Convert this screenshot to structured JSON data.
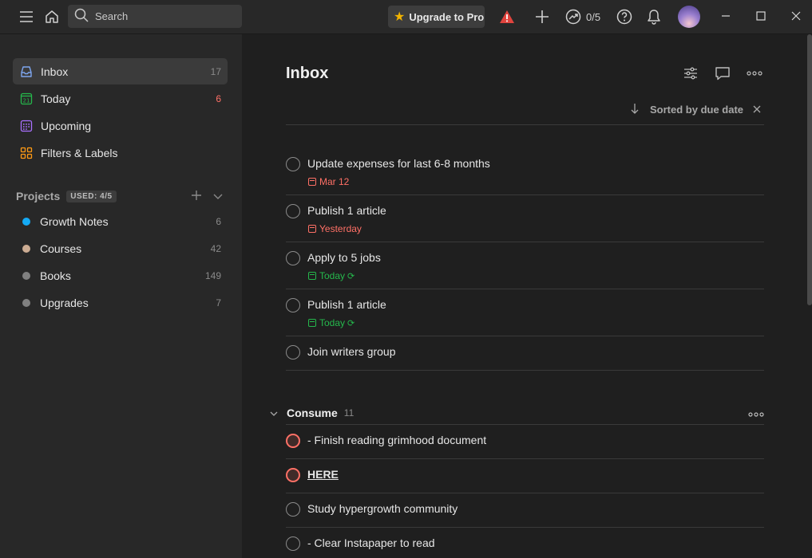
{
  "topbar": {
    "search_placeholder": "Search",
    "upgrade_label": "Upgrade to Pro",
    "karma_label": "0/5"
  },
  "sidebar": {
    "nav": [
      {
        "label": "Inbox",
        "count": "17",
        "icon": "inbox-icon",
        "color": "#7ea6f0"
      },
      {
        "label": "Today",
        "count": "6",
        "icon": "calendar-today-icon",
        "color": "#25b84c"
      },
      {
        "label": "Upcoming",
        "count": "",
        "icon": "calendar-grid-icon",
        "color": "#a970ff"
      },
      {
        "label": "Filters & Labels",
        "count": "",
        "icon": "filters-icon",
        "color": "#ff9a14"
      }
    ],
    "projects_label": "Projects",
    "used_badge": "USED: 4/5",
    "projects": [
      {
        "label": "Growth Notes",
        "count": "6",
        "color": "#14aaf5"
      },
      {
        "label": "Courses",
        "count": "42",
        "color": "#ccac93"
      },
      {
        "label": "Books",
        "count": "149",
        "color": "#808080"
      },
      {
        "label": "Upgrades",
        "count": "7",
        "color": "#808080"
      }
    ]
  },
  "main": {
    "title": "Inbox",
    "sort_label": "Sorted by due date",
    "tasks": [
      {
        "title": "Update expenses for last 6-8 months",
        "due": "Mar 12",
        "due_color": "red"
      },
      {
        "title": "Publish 1 article",
        "due": "Yesterday",
        "due_color": "red"
      },
      {
        "title": "Apply to 5 jobs",
        "due": "Today",
        "due_color": "green"
      },
      {
        "title": "Publish 1 article",
        "due": "Today",
        "due_color": "green"
      },
      {
        "title": "Join writers group",
        "due": "",
        "due_color": ""
      }
    ],
    "section": {
      "name": "Consume",
      "count": "11",
      "tasks": [
        {
          "title": "- Finish reading grimhood document",
          "priority": "p1"
        },
        {
          "title": "HERE",
          "priority": "p1"
        },
        {
          "title": "Study hypergrowth community",
          "priority": "none"
        },
        {
          "title": "- Clear Instapaper to read",
          "priority": "none"
        }
      ]
    }
  }
}
